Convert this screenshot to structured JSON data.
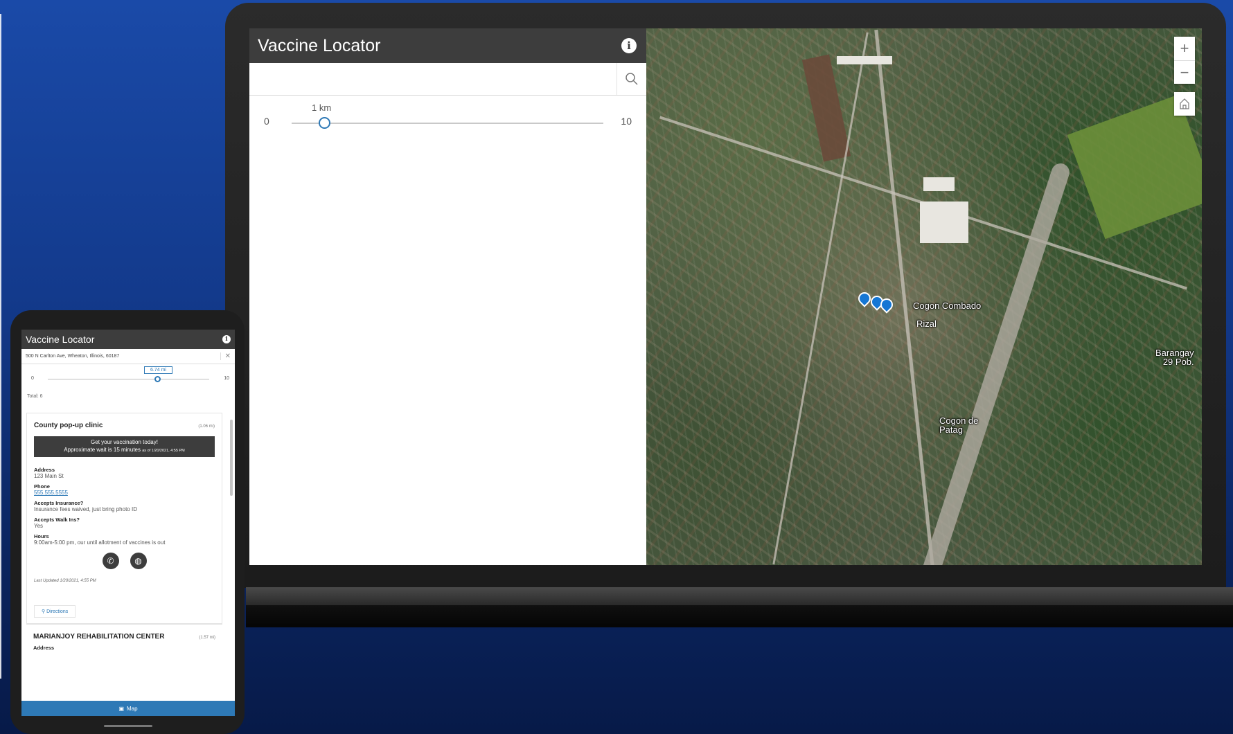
{
  "desktop": {
    "app_title": "Vaccine Locator",
    "search": {
      "value": "",
      "placeholder": ""
    },
    "slider": {
      "min_label": "0",
      "max_label": "10",
      "value_label": "1 km",
      "value": 1
    },
    "map": {
      "labels": {
        "cogon_combado": "Cogon Combado",
        "rizal": "Rizal",
        "barangay": "Barangay\n29 Pob.",
        "cogon_de_patag": "Cogon de\nPatag"
      },
      "zoom_in": "+",
      "zoom_out": "−"
    }
  },
  "mobile": {
    "app_title": "Vaccine Locator",
    "search_value": "500 N Carlton Ave, Wheaton, Illinois, 60187",
    "slider": {
      "min_label": "0",
      "max_label": "10",
      "value_label": "6.74 mi",
      "value": 6.74
    },
    "total_label": "Total: 6",
    "card1": {
      "name": "County pop-up clinic",
      "distance": "(1.06 mi)",
      "banner_line1": "Get your vaccination today!",
      "banner_line2": "Approximate wait is 15 minutes",
      "banner_asof": "as of 1/20/2021, 4:55 PM",
      "address_label": "Address",
      "address_value": "123 Main St",
      "phone_label": "Phone",
      "phone_value": "555.555.5555",
      "insurance_label": "Accepts Insurance?",
      "insurance_value": "Insurance fees waived, just bring photo ID",
      "walkins_label": "Accepts Walk Ins?",
      "walkins_value": "Yes",
      "hours_label": "Hours",
      "hours_value": "9:00am-5:00 pm, our until allotment of vaccines is out",
      "last_updated": "Last Updated 1/20/2021, 4:55 PM",
      "directions_label": "Directions"
    },
    "card2": {
      "name": "MARIANJOY REHABILITATION CENTER",
      "distance": "(1.57 mi)",
      "address_label": "Address"
    },
    "footer_label": "Map"
  },
  "colors": {
    "accent": "#2e79b6",
    "header": "#3d3d3d",
    "pin": "#1576d4"
  }
}
